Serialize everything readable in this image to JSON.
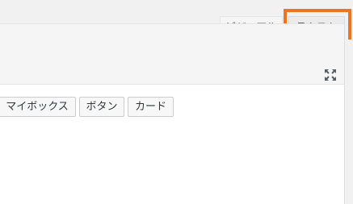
{
  "editor_tabs": {
    "visual_label": "ビジュアル",
    "text_label": "テキスト"
  },
  "quicktags": {
    "buttons": [
      "マイボックス",
      "ボタン",
      "カード"
    ]
  },
  "icons": {
    "fullscreen": "fullscreen-icon"
  },
  "colors": {
    "highlight": "#f0731e"
  }
}
